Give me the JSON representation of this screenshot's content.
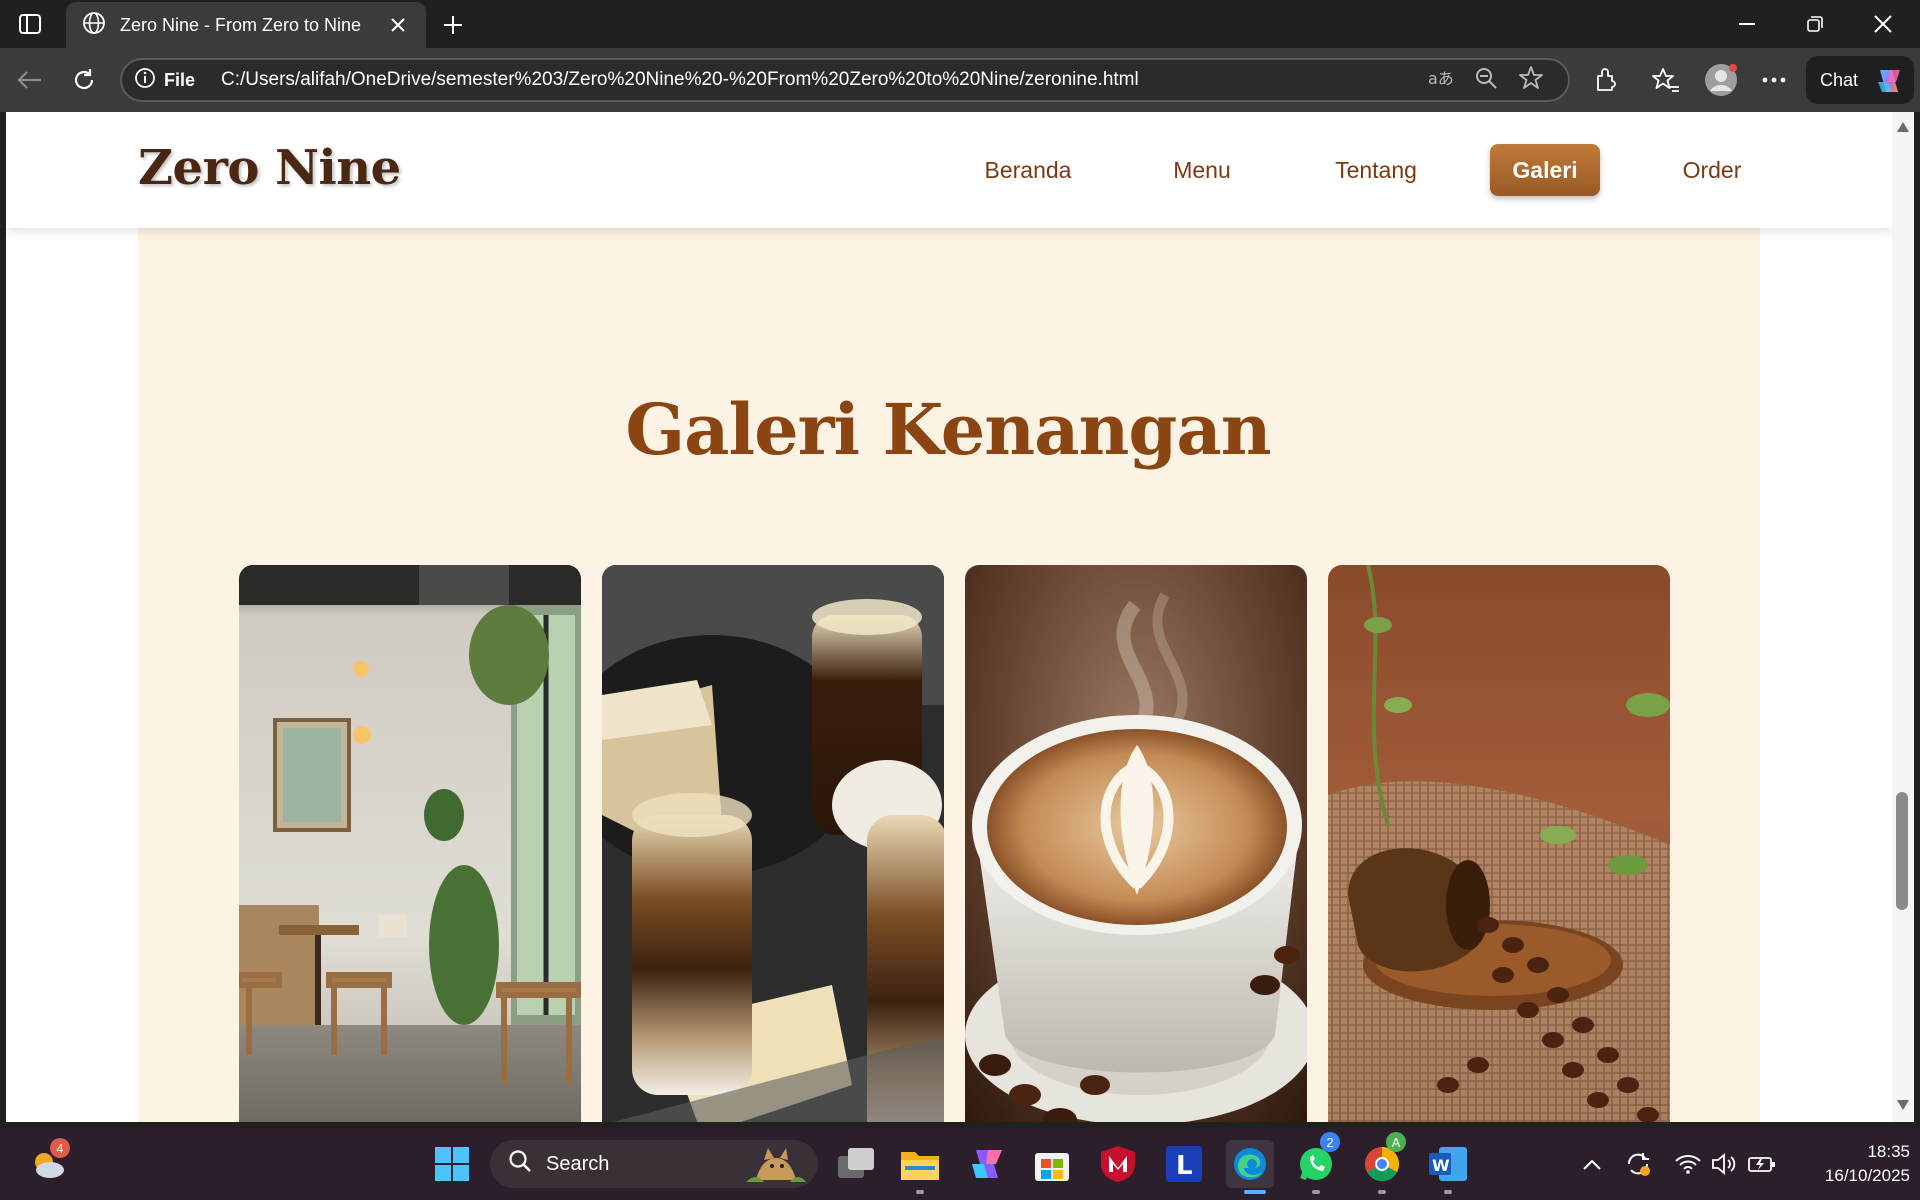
{
  "browser": {
    "tab_title": "Zero Nine - From Zero to Nine",
    "file_label": "File",
    "url": "C:/Users/alifah/OneDrive/semester%203/Zero%20Nine%20-%20From%20Zero%20to%20Nine/zeronine.html",
    "chat_label": "Chat"
  },
  "site": {
    "logo": "Zero Nine",
    "nav": [
      {
        "label": "Beranda"
      },
      {
        "label": "Menu"
      },
      {
        "label": "Tentang"
      },
      {
        "label": "Galeri",
        "active": true
      },
      {
        "label": "Order"
      }
    ],
    "gallery_title": "Galeri Kenangan",
    "photos": [
      "cafe-interior",
      "iced-coffee-drinks",
      "latte-art-cup",
      "coffee-beans-cup"
    ]
  },
  "taskbar": {
    "search_label": "Search",
    "weather_badge": "4",
    "whatsapp_badge": "2",
    "chrome_badge": "A",
    "time": "18:35",
    "date": "16/10/2025"
  },
  "colors": {
    "brand_dark": "#4a2713",
    "brand": "#8b4513",
    "nav_active": "#a8632c",
    "section_bg": "#fdf3e4"
  }
}
